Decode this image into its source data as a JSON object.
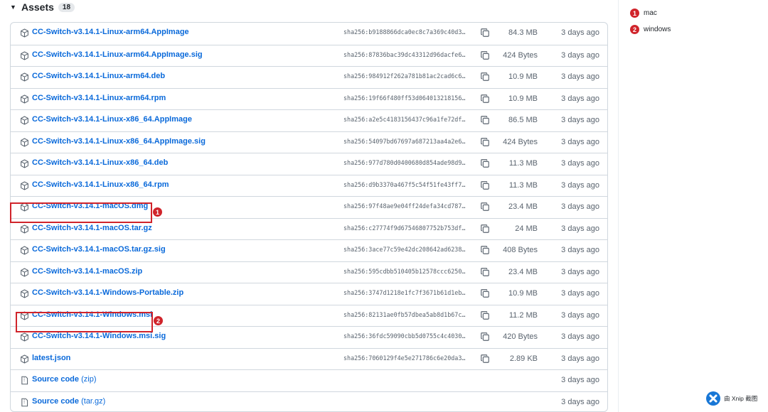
{
  "assets": {
    "title": "Assets",
    "count": "18",
    "rows": [
      {
        "name": "CC-Switch-v3.14.1-Linux-arm64.AppImage",
        "sha": "sha256:b9188866dca0ec8c7a369c40d3…",
        "size": "84.3 MB",
        "date": "3 days ago"
      },
      {
        "name": "CC-Switch-v3.14.1-Linux-arm64.AppImage.sig",
        "sha": "sha256:87836bac39dc43312d96dacfe6…",
        "size": "424 Bytes",
        "date": "3 days ago"
      },
      {
        "name": "CC-Switch-v3.14.1-Linux-arm64.deb",
        "sha": "sha256:984912f262a781b81ac2cad6c6…",
        "size": "10.9 MB",
        "date": "3 days ago"
      },
      {
        "name": "CC-Switch-v3.14.1-Linux-arm64.rpm",
        "sha": "sha256:19f66f480ff53d064013218156…",
        "size": "10.9 MB",
        "date": "3 days ago"
      },
      {
        "name": "CC-Switch-v3.14.1-Linux-x86_64.AppImage",
        "sha": "sha256:a2e5c4183156437c96a1fe72df…",
        "size": "86.5 MB",
        "date": "3 days ago"
      },
      {
        "name": "CC-Switch-v3.14.1-Linux-x86_64.AppImage.sig",
        "sha": "sha256:54097bd67697a687213aa4a2e6…",
        "size": "424 Bytes",
        "date": "3 days ago"
      },
      {
        "name": "CC-Switch-v3.14.1-Linux-x86_64.deb",
        "sha": "sha256:977d780d0400680d854ade98d9…",
        "size": "11.3 MB",
        "date": "3 days ago"
      },
      {
        "name": "CC-Switch-v3.14.1-Linux-x86_64.rpm",
        "sha": "sha256:d9b3370a467f5c54f51fe43ff7…",
        "size": "11.3 MB",
        "date": "3 days ago"
      },
      {
        "name": "CC-Switch-v3.14.1-macOS.dmg",
        "sha": "sha256:97f48ae9e04ff24defa34cd787…",
        "size": "23.4 MB",
        "date": "3 days ago"
      },
      {
        "name": "CC-Switch-v3.14.1-macOS.tar.gz",
        "sha": "sha256:c27774f9d67546807752b753df…",
        "size": "24 MB",
        "date": "3 days ago"
      },
      {
        "name": "CC-Switch-v3.14.1-macOS.tar.gz.sig",
        "sha": "sha256:3ace77c59e42dc208642ad6238…",
        "size": "408 Bytes",
        "date": "3 days ago"
      },
      {
        "name": "CC-Switch-v3.14.1-macOS.zip",
        "sha": "sha256:595cdbb510405b12578ccc6250…",
        "size": "23.4 MB",
        "date": "3 days ago"
      },
      {
        "name": "CC-Switch-v3.14.1-Windows-Portable.zip",
        "sha": "sha256:3747d1218e1fc7f3671b61d1eb…",
        "size": "10.9 MB",
        "date": "3 days ago"
      },
      {
        "name": "CC-Switch-v3.14.1-Windows.msi",
        "sha": "sha256:82131ae0fb57dbea5ab8d1b67c…",
        "size": "11.2 MB",
        "date": "3 days ago"
      },
      {
        "name": "CC-Switch-v3.14.1-Windows.msi.sig",
        "sha": "sha256:36fdc59090cbb5d0755c4c4030…",
        "size": "420 Bytes",
        "date": "3 days ago"
      },
      {
        "name": "latest.json",
        "sha": "sha256:7060129f4e5e271786c6e20da3…",
        "size": "2.89 KB",
        "date": "3 days ago"
      }
    ],
    "source_rows": [
      {
        "name": "Source code",
        "type": "(zip)",
        "date": "3 days ago"
      },
      {
        "name": "Source code",
        "type": "(tar.gz)",
        "date": "3 days ago"
      }
    ]
  },
  "annotations": {
    "marker_1": "1",
    "marker_2": "2",
    "legend": [
      {
        "num": "1",
        "label": "mac"
      },
      {
        "num": "2",
        "label": "windows"
      }
    ],
    "color": "#d0242b"
  },
  "watermark": {
    "text": "由 Xnip 截图"
  },
  "colors": {
    "link": "#0969da",
    "muted": "#59636e",
    "border": "#d0d7de"
  }
}
